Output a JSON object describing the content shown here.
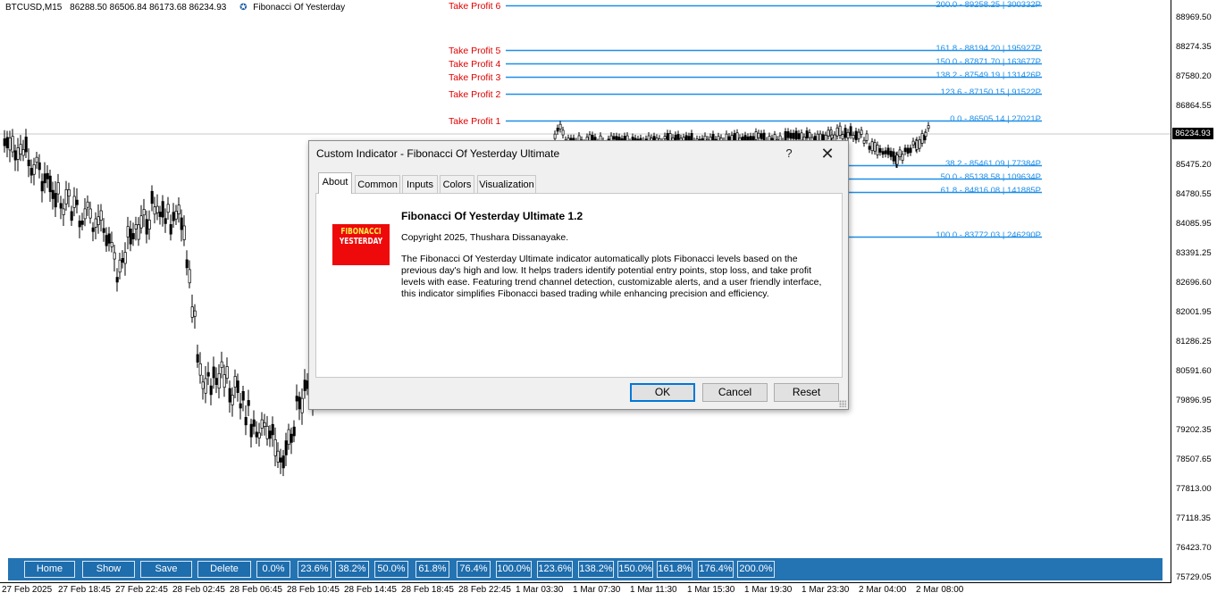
{
  "chart": {
    "symbol": "BTCUSD,M15",
    "ohlc": "86288.50 86506.84 86173.68 86234.93",
    "indicator_name": "Fibonacci Of Yesterday",
    "current_price": "86234.93",
    "colors": {
      "take_profit": "#e00000",
      "fib_line": "#1f8ee8",
      "toolbar": "#2474b3",
      "candle": "#000000"
    },
    "price_axis": [
      "88969.50",
      "88274.35",
      "87580.20",
      "86864.55",
      "85475.20",
      "84780.55",
      "84085.95",
      "83391.25",
      "82696.60",
      "82001.95",
      "81286.25",
      "80591.60",
      "79896.95",
      "79202.35",
      "78507.65",
      "77813.00",
      "77118.35",
      "76423.70",
      "75729.05"
    ],
    "time_axis": [
      "27 Feb 2025",
      "27 Feb 18:45",
      "27 Feb 22:45",
      "28 Feb 02:45",
      "28 Feb 06:45",
      "28 Feb 10:45",
      "28 Feb 14:45",
      "28 Feb 18:45",
      "28 Feb 22:45",
      "1 Mar 03:30",
      "1 Mar 07:30",
      "1 Mar 11:30",
      "1 Mar 15:30",
      "1 Mar 19:30",
      "1 Mar 23:30",
      "2 Mar 04:00",
      "2 Mar 08:00"
    ],
    "take_profits": [
      "Take Profit 6",
      "Take Profit 5",
      "Take Profit 4",
      "Take Profit 3",
      "Take Profit 2",
      "Take Profit 1"
    ],
    "fib_levels": [
      "200.0 - 89258.25 | 300332P",
      "161.8 - 88194.20 | 195927P",
      "150.0 - 87871.70 | 163677P",
      "138.2 - 87549.19 | 131426P",
      "123.6 - 87150.15 | 91522P",
      "0.0 - 86505.14 | 27021P",
      "38.2 - 85461.09 | 77384P",
      "50.0 - 85138.58 | 109634P",
      "61.8 - 84816.08 | 141885P",
      "100.0 - 83772.03 | 246290P"
    ]
  },
  "toolbar": {
    "buttons": [
      "Home",
      "Show",
      "Save",
      "Delete"
    ],
    "levels": [
      "0.0%",
      "23.6%",
      "38.2%",
      "50.0%",
      "61.8%",
      "76.4%",
      "100.0%",
      "123.6%",
      "138.2%",
      "150.0%",
      "161.8%",
      "176.4%",
      "200.0%"
    ]
  },
  "dialog": {
    "title": "Custom Indicator - Fibonacci Of Yesterday Ultimate",
    "help": "?",
    "close": "✕",
    "tabs": [
      "About",
      "Common",
      "Inputs",
      "Colors",
      "Visualization"
    ],
    "logo_line1": "FIBONACCI",
    "logo_line2": "YESTERDAY",
    "about_title": "Fibonacci Of Yesterday Ultimate 1.2",
    "copyright": "Copyright 2025, Thushara Dissanayake.",
    "description": "The Fibonacci Of Yesterday Ultimate indicator automatically plots Fibonacci levels based on the previous day's high and low. It helps traders identify potential entry points, stop loss, and take profit levels with ease. Featuring trend channel detection, customizable alerts, and a user friendly interface, this indicator simplifies Fibonacci based trading while enhancing precision and efficiency.",
    "ok": "OK",
    "cancel": "Cancel",
    "reset": "Reset"
  }
}
